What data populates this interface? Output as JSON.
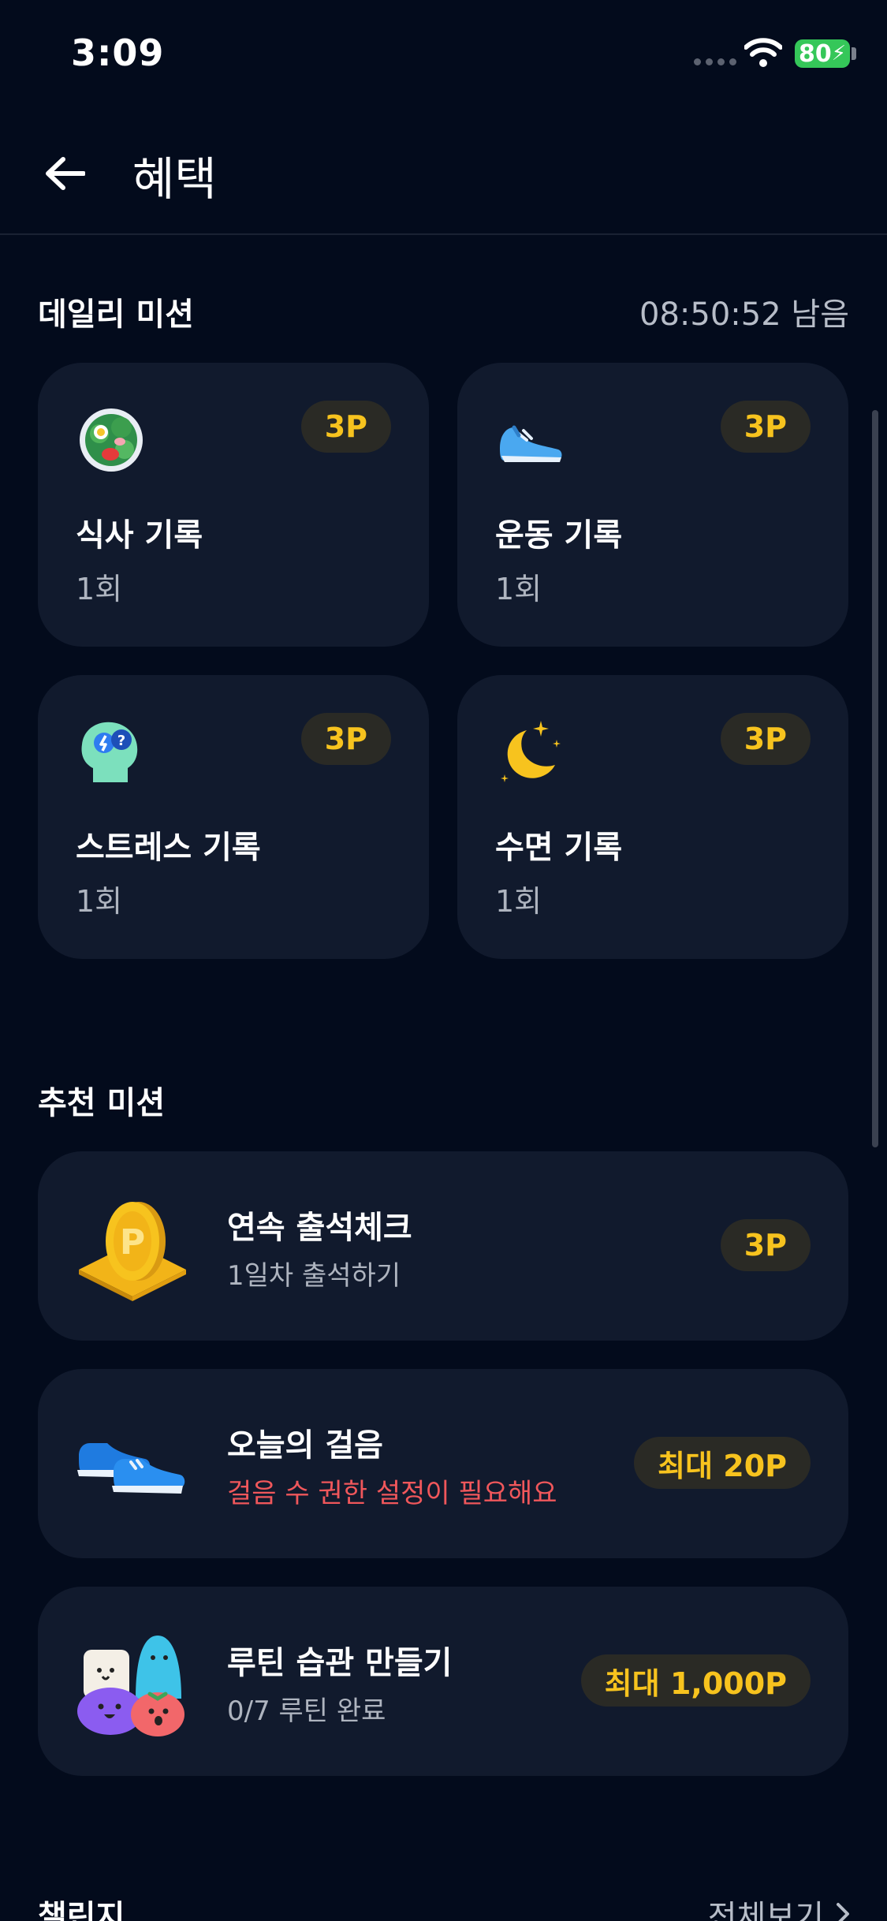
{
  "status_bar": {
    "time": "3:09",
    "battery": "80"
  },
  "header": {
    "title": "혜택"
  },
  "daily": {
    "title": "데일리 미션",
    "remaining": "08:50:52 남음",
    "missions": [
      {
        "name": "식사 기록",
        "count": "1회",
        "points": "3P",
        "icon": "salad-bowl-icon"
      },
      {
        "name": "운동 기록",
        "count": "1회",
        "points": "3P",
        "icon": "running-shoe-icon"
      },
      {
        "name": "스트레스 기록",
        "count": "1회",
        "points": "3P",
        "icon": "stress-head-icon"
      },
      {
        "name": "수면 기록",
        "count": "1회",
        "points": "3P",
        "icon": "moon-stars-icon"
      }
    ]
  },
  "recommended": {
    "title": "추천 미션",
    "items": [
      {
        "title": "연속 출석체크",
        "subtitle": "1일차 출석하기",
        "reward": "3P",
        "icon": "gold-coin-icon"
      },
      {
        "title": "오늘의 걸음",
        "subtitle": "걸음 수 권한 설정이 필요해요",
        "reward": "최대 20P",
        "icon": "sneakers-icon"
      },
      {
        "title": "루틴 습관 만들기",
        "subtitle": "0/7 루틴 완료",
        "reward": "최대 1,000P",
        "icon": "character-group-icon"
      }
    ]
  },
  "challenge": {
    "title": "챌린지",
    "see_all": "전체보기"
  },
  "colors": {
    "background": "#030b1c",
    "card": "#111a2d",
    "accent": "#f7c31e",
    "warning": "#f0575b"
  }
}
